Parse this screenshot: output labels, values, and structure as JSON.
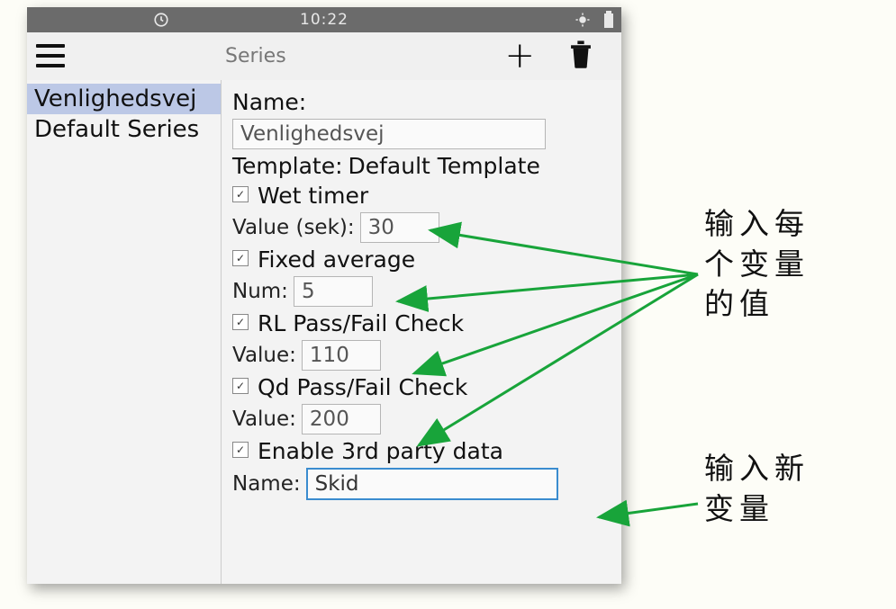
{
  "status": {
    "time": "10:22"
  },
  "toolbar": {
    "title": "Series"
  },
  "sidebar": {
    "items": [
      {
        "label": "Venlighedsvej",
        "selected": true
      },
      {
        "label": "Default Series",
        "selected": false
      }
    ]
  },
  "form": {
    "name_label": "Name:",
    "name_value": "Venlighedsvej",
    "template_label": "Template:",
    "template_value": "Default Template",
    "wet_timer": {
      "checked": true,
      "label": "Wet timer",
      "value_label": "Value (sek):",
      "value": "30"
    },
    "fixed_average": {
      "checked": true,
      "label": "Fixed average",
      "num_label": "Num:",
      "value": "5"
    },
    "rl_check": {
      "checked": true,
      "label": "RL Pass/Fail Check",
      "value_label": "Value:",
      "value": "110"
    },
    "qd_check": {
      "checked": true,
      "label": "Qd Pass/Fail Check",
      "value_label": "Value:",
      "value": "200"
    },
    "third_party": {
      "checked": true,
      "label": "Enable 3rd party data",
      "name_label": "Name:",
      "value": "Skid"
    }
  },
  "annotations": {
    "a1_l1": "输入每",
    "a1_l2": "个变量",
    "a1_l3": "的值",
    "a2_l1": "输入新",
    "a2_l2": "变量"
  }
}
